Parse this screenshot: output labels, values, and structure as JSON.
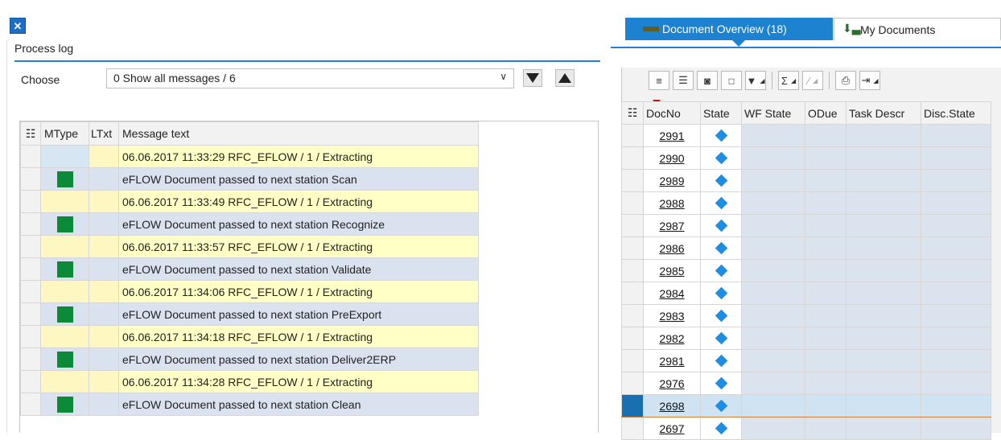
{
  "left_panel": {
    "close_icon": "close-icon",
    "process_log_label": "Process log",
    "choose_label": "Choose",
    "choose_value": "0 Show all messages / 6",
    "down_button": "triangle-down-icon",
    "up_button": "triangle-up-icon",
    "columns": {
      "mtype": "MType",
      "ltxt": "LTxt",
      "msg": "Message text"
    },
    "rows": [
      {
        "kind": "info",
        "text": "06.06.2017 11:33:29 RFC_EFLOW / 1  / Extracting"
      },
      {
        "kind": "ok",
        "text": "eFLOW Document passed to next station Scan"
      },
      {
        "kind": "info",
        "text": "06.06.2017 11:33:49 RFC_EFLOW / 1  / Extracting"
      },
      {
        "kind": "ok",
        "text": "eFLOW Document passed to next station Recognize"
      },
      {
        "kind": "info",
        "text": "06.06.2017 11:33:57 RFC_EFLOW / 1  / Extracting"
      },
      {
        "kind": "ok",
        "text": "eFLOW Document passed to next station Validate"
      },
      {
        "kind": "info",
        "text": "06.06.2017 11:34:06 RFC_EFLOW / 1  / Extracting"
      },
      {
        "kind": "ok",
        "text": "eFLOW Document passed to next station PreExport"
      },
      {
        "kind": "info",
        "text": "06.06.2017 11:34:18 RFC_EFLOW / 1  / Extracting"
      },
      {
        "kind": "ok",
        "text": "eFLOW Document passed to next station Deliver2ERP"
      },
      {
        "kind": "info",
        "text": "06.06.2017 11:34:28 RFC_EFLOW / 1  / Extracting"
      },
      {
        "kind": "ok",
        "text": "eFLOW Document passed to next station Clean"
      }
    ]
  },
  "right_panel": {
    "tab_active": "Document Overview (18)",
    "tab_other": "My Documents",
    "columns": {
      "docno": "DocNo",
      "state": "State",
      "wf_state": "WF State",
      "odue": "ODue",
      "task": "Task Descr",
      "disc": "Disc.State"
    },
    "doc_numbers": [
      "2991",
      "2990",
      "2989",
      "2988",
      "2987",
      "2986",
      "2985",
      "2984",
      "2983",
      "2982",
      "2981",
      "2976",
      "2698",
      "2697"
    ],
    "selected_doc": "2698",
    "toolbar_icons": [
      "align-top-icon",
      "filter-lines-icon",
      "binoculars-icon",
      "find-next-icon",
      "filter-icon",
      "sum-icon",
      "subtotal-icon",
      "print-icon",
      "export-icon"
    ],
    "colors": {
      "accent": "#1d82cf",
      "diamond": "#1c8ee4",
      "ok": "#0c8a37",
      "info_row": "#fff7c2"
    }
  }
}
